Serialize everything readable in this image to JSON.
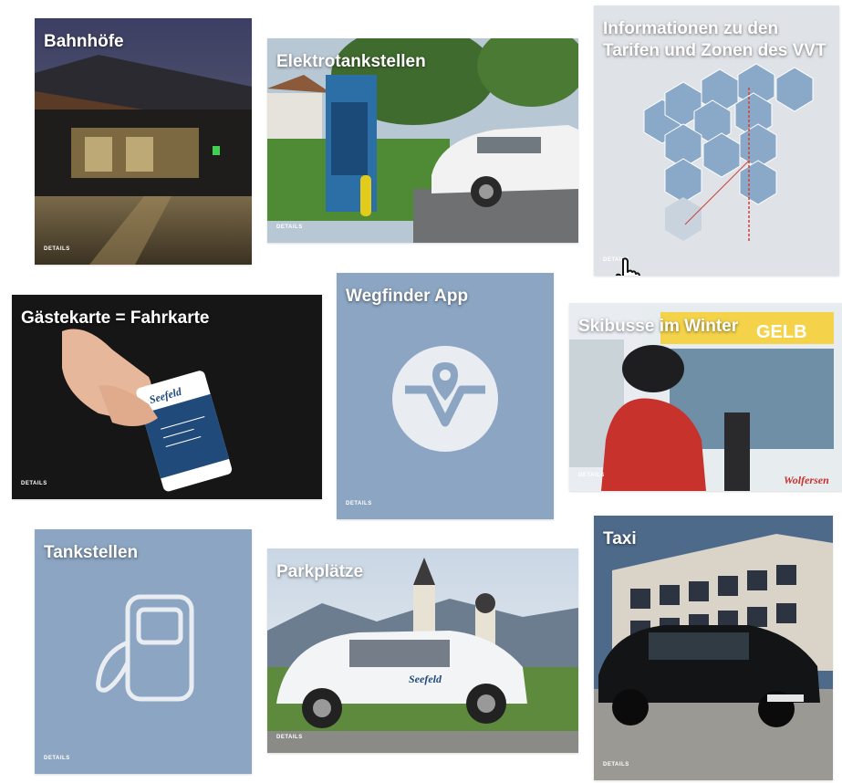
{
  "tiles": {
    "bahnhoefe": {
      "title": "Bahnhöfe",
      "details": "DETAILS"
    },
    "elektro": {
      "title": "Elektrotankstellen",
      "details": "DETAILS"
    },
    "tarife": {
      "title": "Informationen zu den Tarifen und Zonen des VVT",
      "details": "DETAILS"
    },
    "gaestekarte": {
      "title": "Gästekarte = Fahrkarte",
      "details": "DETAILS",
      "card_brand": "Seefeld"
    },
    "wegfinder": {
      "title": "Wegfinder App",
      "details": "DETAILS"
    },
    "skibusse": {
      "title": "Skibusse im Winter",
      "details": "DETAILS",
      "bus_sign": "GELB",
      "bus_brand": "Wolfersen"
    },
    "tankstellen": {
      "title": "Tankstellen",
      "details": "DETAILS"
    },
    "parkplaetze": {
      "title": "Parkplätze",
      "details": "DETAILS",
      "car_brand": "Seefeld"
    },
    "taxi": {
      "title": "Taxi",
      "details": "DETAILS"
    }
  },
  "colors": {
    "tile_blue": "#8ba5c2",
    "hex_blue": "#7d9dc0",
    "white": "#ffffff"
  },
  "icons": [
    "hand-pointer-icon",
    "fuel-pump-icon",
    "wegfinder-logo-icon"
  ]
}
